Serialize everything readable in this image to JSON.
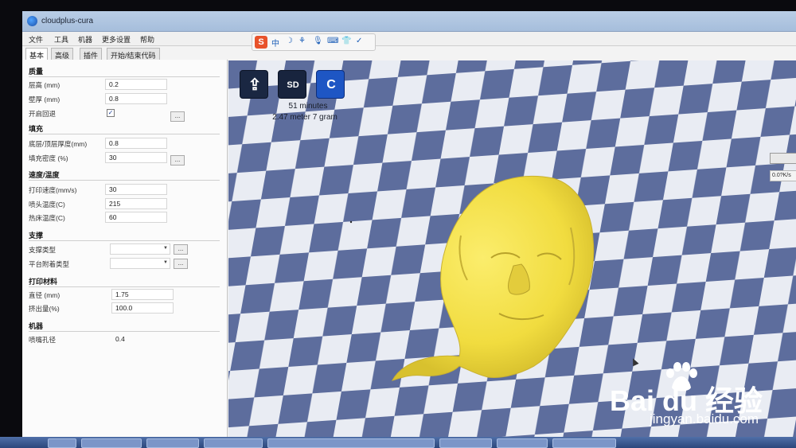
{
  "window": {
    "title": "cloudplus-cura"
  },
  "menu": [
    "文件",
    "工具",
    "机器",
    "更多设置",
    "帮助"
  ],
  "ime": {
    "logo": "S",
    "glyphs": [
      "中",
      "☽",
      "⚘",
      "🎙",
      "⌨",
      "👕",
      "✓"
    ]
  },
  "tabs": [
    "基本",
    "高级",
    "插件",
    "开始/结束代码"
  ],
  "sections": {
    "quality": {
      "title": "质量",
      "layer_height": {
        "label": "层高 (mm)",
        "value": "0.2"
      },
      "shell_thickness": {
        "label": "壁厚 (mm)",
        "value": "0.8"
      },
      "retraction": {
        "label": "开启回退",
        "checked": "✓",
        "button": "..."
      }
    },
    "fill": {
      "title": "填充",
      "bottom_top": {
        "label": "底层/顶层厚度(mm)",
        "value": "0.8"
      },
      "density": {
        "label": "填充密度 (%)",
        "value": "30",
        "button": "..."
      }
    },
    "speed": {
      "title": "速度/温度",
      "print_speed": {
        "label": "打印速度(mm/s)",
        "value": "30"
      },
      "nozzle_temp": {
        "label": "喷头温度(C)",
        "value": "215"
      },
      "bed_temp": {
        "label": "热床温度(C)",
        "value": "60"
      }
    },
    "support": {
      "title": "支撑",
      "support_type": {
        "label": "支撑类型",
        "value": "",
        "button": "..."
      },
      "platform_adhesion": {
        "label": "平台附着类型",
        "value": "",
        "button": "..."
      }
    },
    "filament": {
      "title": "打印材料",
      "diameter": {
        "label": "直径 (mm)",
        "value": "1.75"
      },
      "flow": {
        "label": "挤出量(%)",
        "value": "100.0"
      }
    },
    "machine": {
      "title": "机器",
      "nozzle": {
        "label": "喷嘴孔径",
        "value": "0.4"
      }
    }
  },
  "viewport": {
    "print_time": "51 minutes",
    "print_stats": "2.47 meter 7 gram",
    "load_glyph": "⇪",
    "sd_glyph": "SD",
    "cloud_glyph": "C",
    "widget_label": "0.0?K/s"
  },
  "watermark": {
    "brand": "Bai du 经验",
    "url": "jingyan.baidu.com"
  },
  "colors": {
    "model": "#f2df45",
    "checker_dark": "#5f6f9e",
    "checker_light": "#e8ebf2",
    "accent": "#1e56c4"
  }
}
